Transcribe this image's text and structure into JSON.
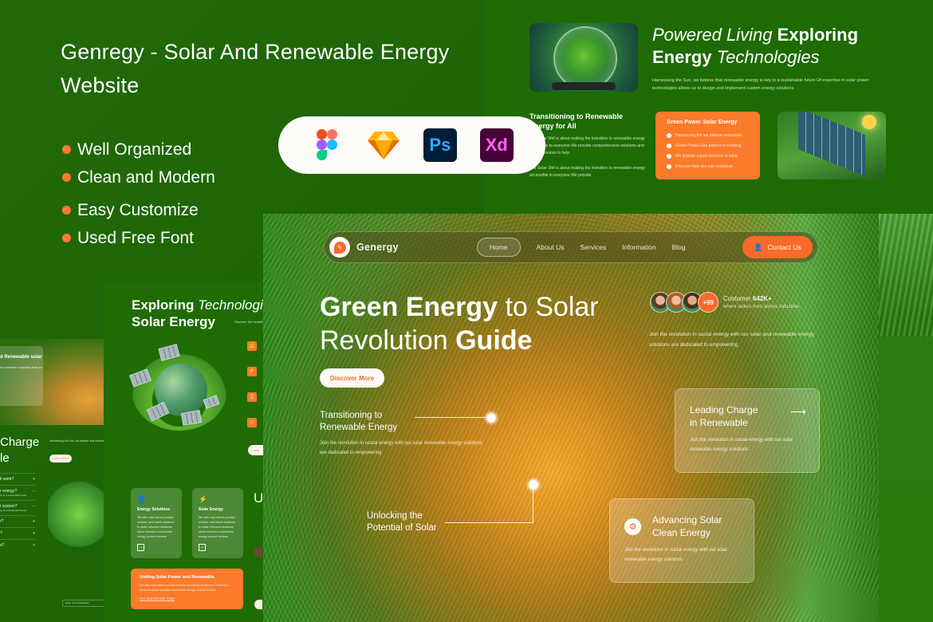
{
  "promo": {
    "title": "Genregy - Solar And Renewable Energy Website",
    "features": [
      "Well Organized",
      "Clean and Modern",
      "Easy Customize",
      "Used Free Font"
    ],
    "tools": [
      "Figma",
      "Sketch",
      "Ps",
      "Xd"
    ],
    "accent_color": "#ff7a2e"
  },
  "preview_top": {
    "heading_italic_1": "Powered Living",
    "heading_bold_1": "Exploring",
    "heading_bold_2": "Energy",
    "heading_italic_2": "Technologies",
    "description": "Harnessing the Sun, we believe that renewable energy is key to a sustainable future Of expertise in solar power technologies allows us to design and implement custom energy solutions",
    "transition_heading_bold": "Transitioning to",
    "transition_heading_rest": "Renewable Energy for All",
    "transition_p1": "The Solar Shif is about making the transition to renewable energy accessible to everyone We provide comprehensive solutions and expert services to help",
    "transition_p2": "The Solar Shif is about making the transition to renewable energy accessible to everyone We provide",
    "orange_card": {
      "title": "Green Power Solar Energy",
      "items": [
        "Harnessing the we believe renewable",
        "Green Power Gen partner in creating",
        "We provide expert services in solar",
        "Discover how you can contribute"
      ]
    }
  },
  "preview_mid": {
    "title_bold_1": "Exploring",
    "title_italic": "Technologies",
    "title_rest": "Solar",
    "title_bold_2": "Energy",
    "desc": "Discover the benefits technologies. Our m",
    "learn": "Learn More",
    "cards": [
      {
        "icon": "user-tool-icon",
        "title": "Energy Solutions",
        "text": "We offer expt advice product reviews, and hands solutions to make informed decisions about transition sustainable energy product reviews"
      },
      {
        "icon": "bolt-icon",
        "title": "Solar Energy",
        "text": "We offer expt advice product reviews, and hands solutions to make informed decisions about transition sustainable energy product reviews"
      }
    ],
    "unite": {
      "title": "Uniting Solar Power and Renewable",
      "text": "We offer expt advice product reviews, and hands solutions to it informed decisions about transition sustainable energy product reviews",
      "link": "Get Started with Solar"
    },
    "right_big": "U a"
  },
  "preview_left": {
    "card_title": "d Renewable solar",
    "card_text": "ke renewable it exploring solar ducts reviews, and hands-on ional transitioning",
    "big_text_1": "Charge",
    "big_text_2": "le",
    "desc": "Harnessing the Sun, we believe that renewable ene expertise in solar power technologies allows us to",
    "learn": "Learn More",
    "faq": [
      {
        "q": "it work?",
        "sign": "+",
        "a": ""
      },
      {
        "q": "r energy?",
        "sign": "−",
        "a": "ey is a sustainable future"
      },
      {
        "q": "r system?",
        "sign": "−",
        "a": "ey is a sustainable future"
      },
      {
        "q": "r?",
        "sign": "+",
        "a": ""
      },
      {
        "q": "?",
        "sign": "+",
        "a": ""
      },
      {
        "q": "s?",
        "sign": "+",
        "a": ""
      }
    ],
    "email_placeholder": "Enter Your Email Here"
  },
  "hero": {
    "brand": "Genergy",
    "nav": [
      {
        "label": "Home",
        "active": true
      },
      {
        "label": "About Us",
        "active": false
      },
      {
        "label": "Services",
        "active": false
      },
      {
        "label": "Information",
        "active": false
      },
      {
        "label": "Blog",
        "active": false
      }
    ],
    "contact": "Contact Us",
    "title_bold_1": "Green Energy",
    "title_light_1": "to Solar",
    "title_light_2": "Revolution",
    "title_bold_2": "Guide",
    "discover": "Discover More",
    "avatars_more": "+99",
    "customer_label": "Costumer",
    "customer_count": "642K+",
    "customer_sub": "where sellers from across industries",
    "description": "Join the revolution in sustai energy with our solar and renewable energy solutions are dedicated to empowering",
    "callout_1": {
      "title_1": "Transitioning to",
      "title_2": "Renewable Energy",
      "text": "Join the revolution in sustai energy with oui solar renewable energy solutions are dedicated to empowering"
    },
    "callout_2": {
      "title_1": "Unlocking the",
      "title_2": "Potential of Solar"
    },
    "card_1": {
      "title_1": "Leading Charge",
      "title_2": "in Renewable",
      "text": "Join the revolution in sustai energy with oui solar renewable energy solutions",
      "arrow": "⟶"
    },
    "card_2": {
      "title_1": "Advancing Solar",
      "title_2": "Clean Energy",
      "text": "Join the revolution in sustai energy with oui solar renewable energy solutions"
    },
    "accent_color": "#fb6a2a"
  }
}
